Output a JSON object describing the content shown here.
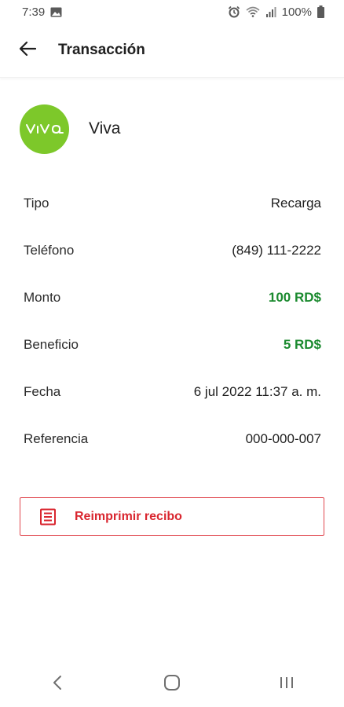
{
  "status_bar": {
    "time": "7:39",
    "battery_text": "100%",
    "icons": [
      "image-icon",
      "alarm-icon",
      "wifi-icon",
      "signal-icon",
      "battery-icon"
    ]
  },
  "app_bar": {
    "title": "Transacción",
    "back_icon": "back-arrow-icon"
  },
  "provider": {
    "logo_text": "VIVA",
    "logo_color": "#7dc82a",
    "name": "Viva"
  },
  "details": [
    {
      "label": "Tipo",
      "value": "Recarga"
    },
    {
      "label": "Teléfono",
      "value": "(849) 111-2222"
    },
    {
      "label": "Monto",
      "value": "100 RD$",
      "highlight": true
    },
    {
      "label": "Beneficio",
      "value": "5 RD$",
      "highlight": true
    },
    {
      "label": "Fecha",
      "value": "6 jul 2022 11:37 a. m."
    },
    {
      "label": "Referencia",
      "value": "000-000-007"
    }
  ],
  "actions": {
    "reprint_label": "Reimprimir recibo",
    "reprint_icon": "receipt-icon",
    "accent_color": "#d9262f"
  },
  "colors": {
    "positive_amount": "#1b8a2f"
  },
  "nav_bar": {
    "icons": [
      "back-nav-icon",
      "home-nav-icon",
      "recents-nav-icon"
    ]
  }
}
